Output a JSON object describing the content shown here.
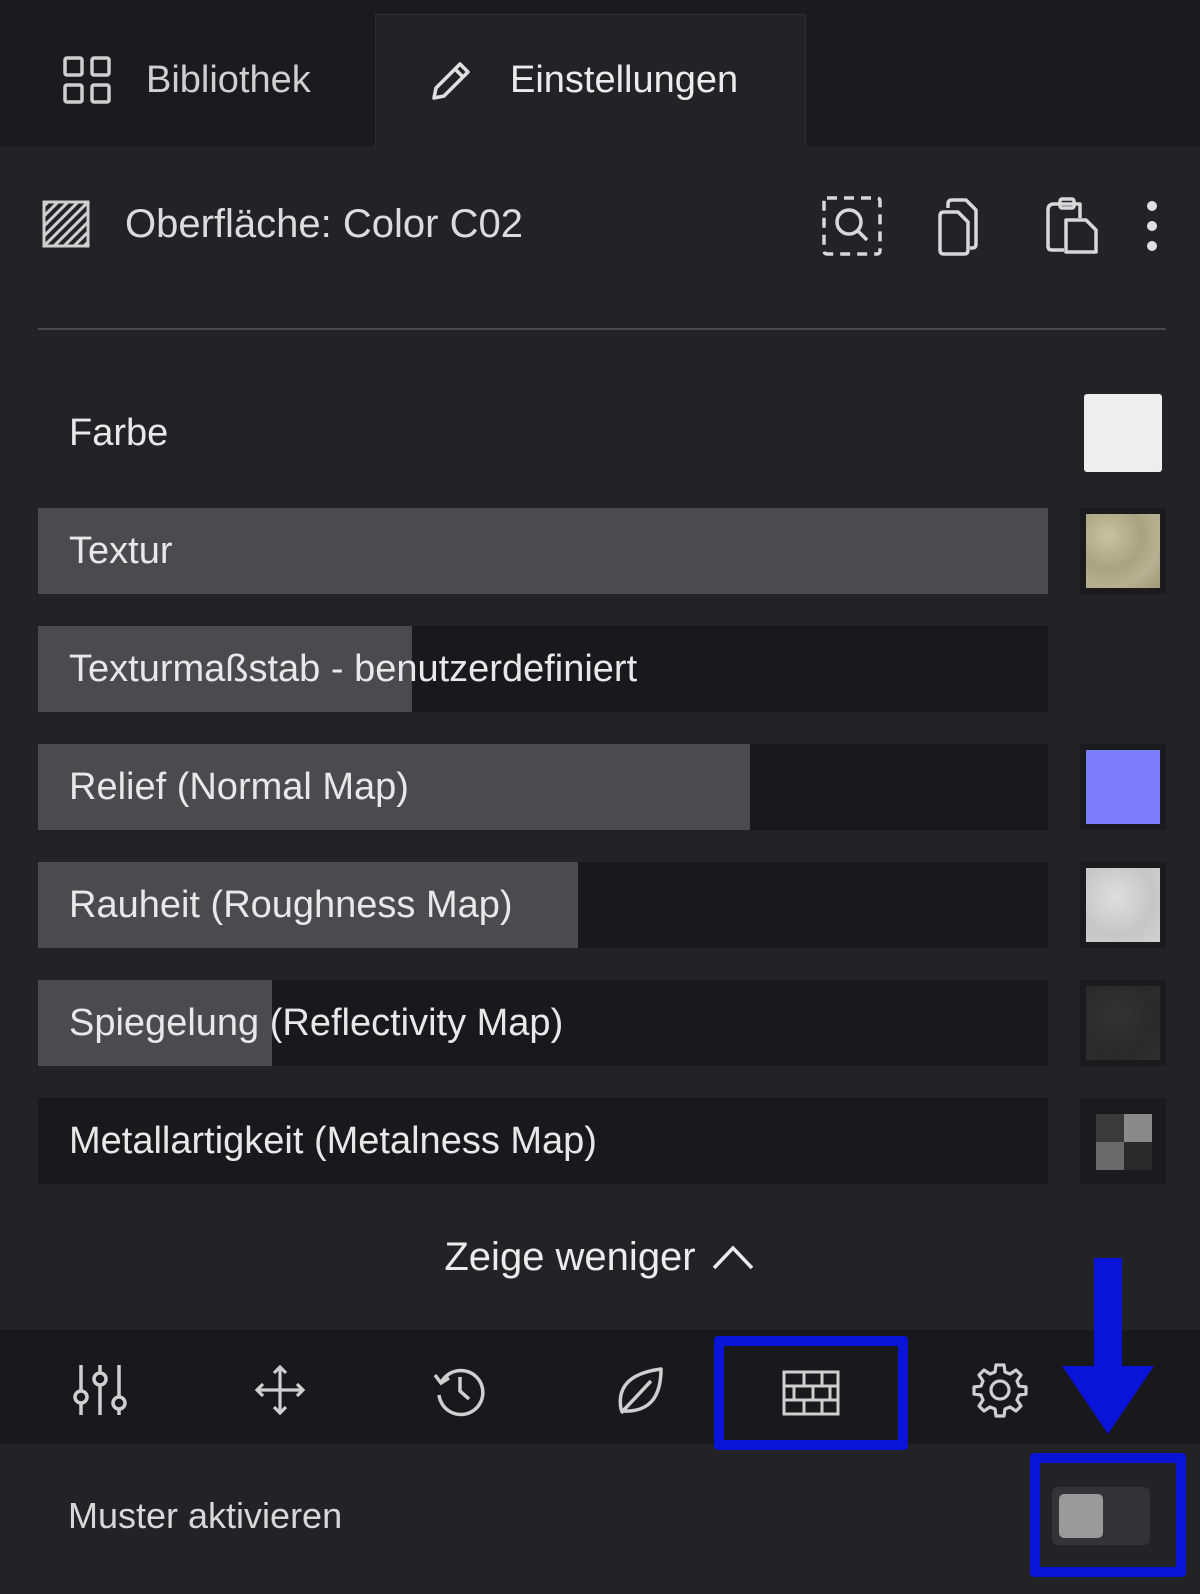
{
  "tabs": {
    "library": {
      "label": "Bibliothek",
      "icon": "grid-icon"
    },
    "settings": {
      "label": "Einstellungen",
      "icon": "pencil-icon",
      "active": true
    }
  },
  "header": {
    "title": "Oberfläche: Color C02",
    "icon": "hatched-surface-icon",
    "actions": [
      "select-area-icon",
      "copy-icon",
      "paste-icon",
      "more-vertical-icon"
    ]
  },
  "properties": [
    {
      "label": "Farbe",
      "fill": null,
      "swatch": "#eeeeee"
    },
    {
      "label": "Textur",
      "fill": 1.0,
      "swatch": "texture-beige"
    },
    {
      "label": "Texturmaßstab - benutzerdefiniert",
      "fill": 0.37,
      "swatch": null
    },
    {
      "label": "Relief (Normal Map)",
      "fill": 0.705,
      "swatch": "#7d7dfb"
    },
    {
      "label": "Rauheit (Roughness Map)",
      "fill": 0.535,
      "swatch": "texture-lightgrey"
    },
    {
      "label": "Spiegelung (Reflectivity Map)",
      "fill": 0.232,
      "swatch": "texture-dark"
    },
    {
      "label": "Metallartigkeit (Metalness Map)",
      "fill": 0,
      "swatch": "checker-icon"
    }
  ],
  "show_less": {
    "label": "Zeige weniger",
    "icon": "chevron-up-icon"
  },
  "toolbar": [
    "sliders-icon",
    "move-icon",
    "history-icon",
    "leaf-icon",
    "brick-pattern-icon",
    "gear-icon"
  ],
  "pattern": {
    "label": "Muster aktivieren",
    "enabled": false
  },
  "colors": {
    "highlight": "#0a14d6",
    "background": "#232326",
    "row_fill": "#4b4b4e"
  }
}
